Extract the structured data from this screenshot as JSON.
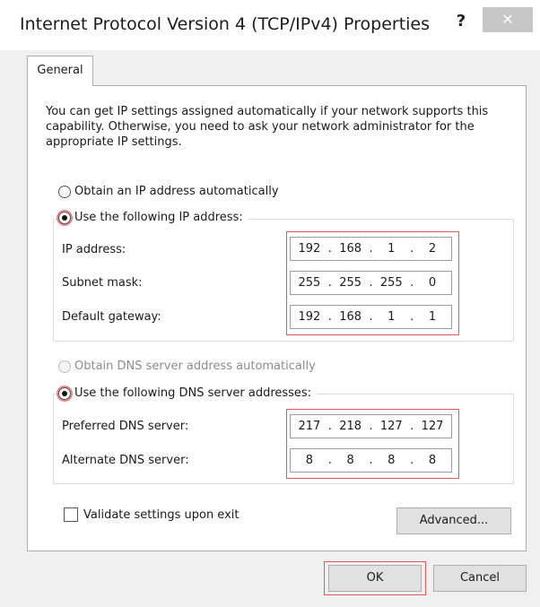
{
  "window": {
    "title": "Internet Protocol Version 4 (TCP/IPv4) Properties",
    "help_label": "?",
    "close_label": "✕"
  },
  "tabs": [
    {
      "label": "General"
    }
  ],
  "general": {
    "intro": "You can get IP settings assigned automatically if your network supports this capability. Otherwise, you need to ask your network administrator for the appropriate IP settings.",
    "ip_mode": {
      "auto_label": "Obtain an IP address automatically",
      "manual_label": "Use the following IP address:",
      "selected": "manual"
    },
    "ip_fields": {
      "ip_address": {
        "label": "IP address:",
        "octets": [
          "192",
          "168",
          "1",
          "2"
        ]
      },
      "subnet_mask": {
        "label": "Subnet mask:",
        "octets": [
          "255",
          "255",
          "255",
          "0"
        ]
      },
      "default_gateway": {
        "label": "Default gateway:",
        "octets": [
          "192",
          "168",
          "1",
          "1"
        ]
      }
    },
    "dns_mode": {
      "auto_label": "Obtain DNS server address automatically",
      "manual_label": "Use the following DNS server addresses:",
      "selected": "manual",
      "auto_disabled": true
    },
    "dns_fields": {
      "preferred": {
        "label": "Preferred DNS server:",
        "octets": [
          "217",
          "218",
          "127",
          "127"
        ]
      },
      "alternate": {
        "label": "Alternate DNS server:",
        "octets": [
          "8",
          "8",
          "8",
          "8"
        ]
      }
    },
    "validate_label": "Validate settings upon exit",
    "validate_checked": false,
    "advanced_label": "Advanced..."
  },
  "footer": {
    "ok_label": "OK",
    "cancel_label": "Cancel"
  },
  "colors": {
    "highlight": "#e05a5a",
    "close_button_bg": "#c7c7c7"
  }
}
